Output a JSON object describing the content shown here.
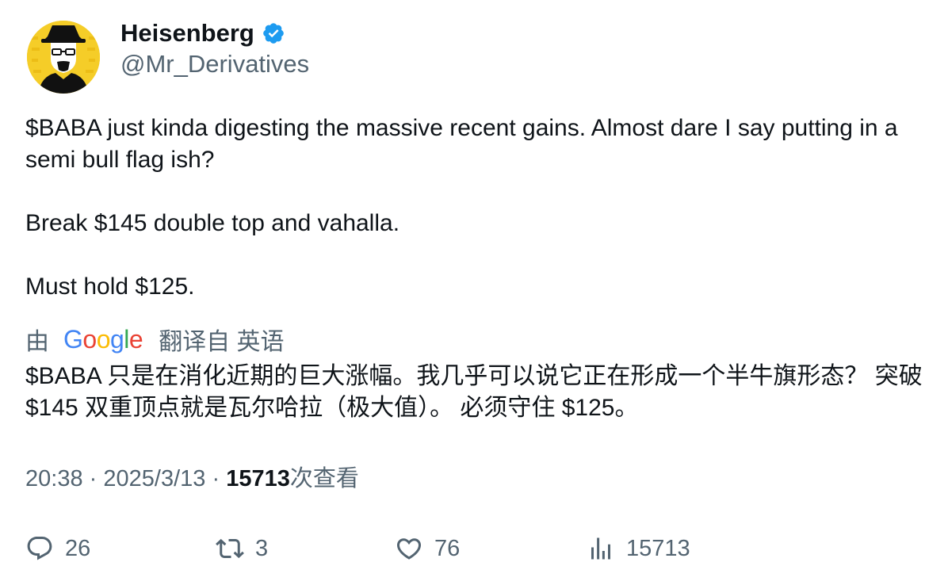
{
  "author": {
    "display_name": "Heisenberg",
    "handle": "@Mr_Derivatives",
    "verified_icon": "verified-badge-icon",
    "avatar_icon": "heisenberg-avatar"
  },
  "tweet": {
    "paragraphs": [
      "$BABA just kinda digesting the massive recent gains. Almost dare I say putting in a semi bull flag ish?",
      "Break $145 double top and vahalla.",
      "Must hold $125."
    ]
  },
  "translation": {
    "prefix": "由",
    "provider": "Google",
    "link": "翻译自 英语",
    "text": "$BABA 只是在消化近期的巨大涨幅。我几乎可以说它正在形成一个半牛旗形态？ 突破 $145 双重顶点就是瓦尔哈拉（极大值）。 必须守住 $125。"
  },
  "meta": {
    "time": "20:38",
    "separator": "·",
    "date": "2025/3/13",
    "views_count": "15713",
    "views_label": "次查看"
  },
  "actions": {
    "replies": "26",
    "retweets": "3",
    "likes": "76",
    "views": "15713"
  },
  "colors": {
    "text_primary": "#0f1419",
    "text_secondary": "#536471",
    "verified_blue": "#1d9bf0",
    "avatar_yellow": "#f5cd28",
    "google_blue": "#4285f4",
    "google_red": "#ea4335",
    "google_yellow": "#fbbc05",
    "google_green": "#34a853"
  }
}
